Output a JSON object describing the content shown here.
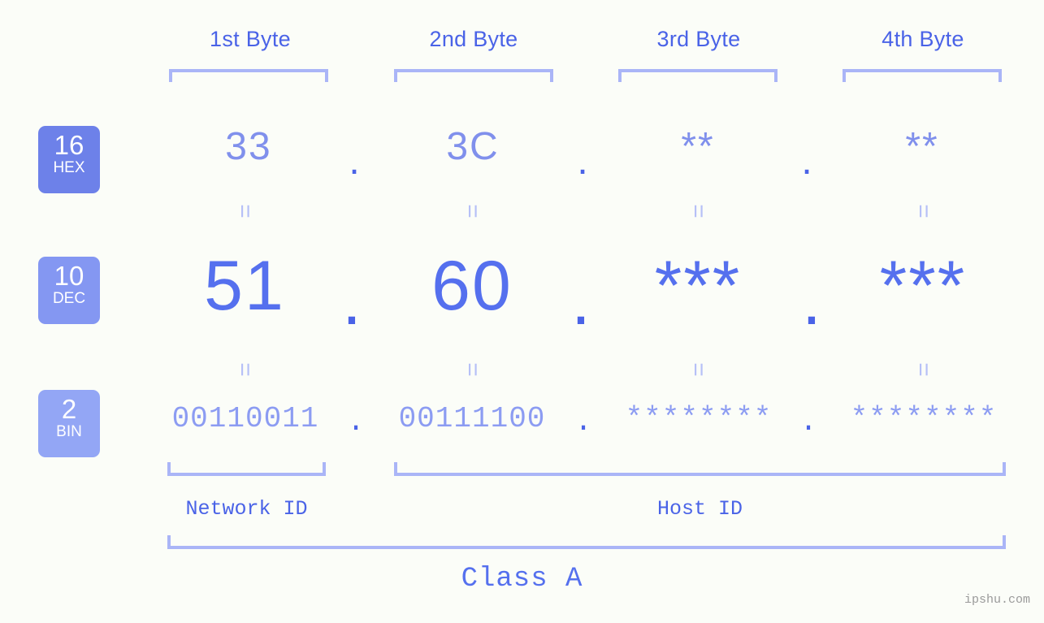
{
  "columns": [
    {
      "header": "1st Byte",
      "hex": "33",
      "dec": "51",
      "bin": "00110011"
    },
    {
      "header": "2nd Byte",
      "hex": "3C",
      "dec": "60",
      "bin": "00111100"
    },
    {
      "header": "3rd Byte",
      "hex": "**",
      "dec": "***",
      "bin": "********"
    },
    {
      "header": "4th Byte",
      "hex": "**",
      "dec": "***",
      "bin": "********"
    }
  ],
  "separators": {
    "hex_dot": ".",
    "dec_dot": ".",
    "bin_dot": "."
  },
  "bases": [
    {
      "number": "16",
      "abbr": "HEX"
    },
    {
      "number": "10",
      "abbr": "DEC"
    },
    {
      "number": "2",
      "abbr": "BIN"
    }
  ],
  "equality_mark": "=",
  "segments": {
    "network_id": "Network ID",
    "host_id": "Host ID",
    "class": "Class A"
  },
  "watermark": "ipshu.com",
  "colors": {
    "background": "#fbfdf8",
    "accent_strong": "#4a63e7",
    "accent_dec": "#5570ee",
    "accent_hex": "#8090ec",
    "accent_bin": "#8c9cf2",
    "bracket": "#aab5f7",
    "badge_hex": "#6d81e9",
    "badge_dec": "#8497f2",
    "badge_bin": "#93a6f5",
    "watermark": "#9a9a9a"
  }
}
